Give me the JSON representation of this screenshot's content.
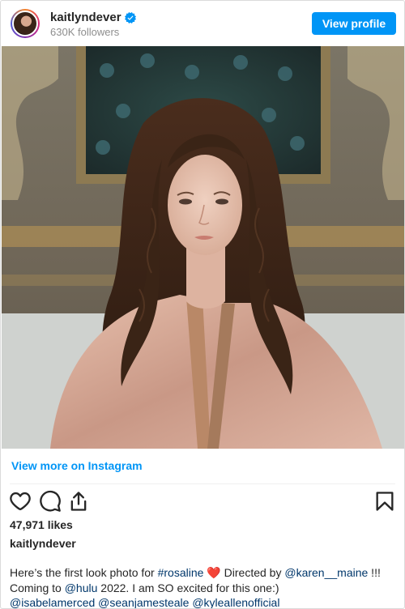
{
  "header": {
    "username": "kaitlyndever",
    "followers": "630K followers",
    "view_profile_label": "View profile"
  },
  "photo": {
    "alt": "First look photo of Rosaline"
  },
  "view_more_label": "View more on Instagram",
  "likes": "47,971 likes",
  "caption": {
    "owner": "kaitlyndever",
    "text1": "Here’s the first look photo for ",
    "tag_rosaline": "#rosaline",
    "heart": "❤️",
    "text2": " Directed by ",
    "mention_karen": "@karen__maine",
    "text3": " !!!",
    "text4": "Coming to ",
    "mention_hulu": "@hulu",
    "text5": " 2022. I am SO excited for this one:)",
    "mention_isabela": "@isabelamerced",
    "mention_sean": "@seanjamesteale",
    "mention_kyle": "@kyleallenofficial"
  },
  "colors": {
    "accent": "#0095f6",
    "link": "#00376b",
    "muted": "#8e8e8e"
  },
  "icons": [
    "verified-badge-icon",
    "heart-icon",
    "comment-icon",
    "share-icon",
    "bookmark-icon"
  ]
}
